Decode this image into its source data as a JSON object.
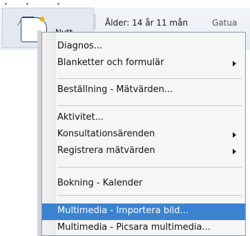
{
  "header": {
    "new_label": "Nytt",
    "age_info": "Ålder: 14 år 11 mån",
    "street_label": "Gatua"
  },
  "menu": {
    "items": [
      {
        "label": "Diagnos..."
      },
      {
        "label": "Blanketter och formulär"
      },
      {
        "label": "Beställning - Mätvärden..."
      },
      {
        "label": "Aktivitet..."
      },
      {
        "label": "Konsultationsärenden"
      },
      {
        "label": "Registrera mätvärden"
      },
      {
        "label": "Bokning - Kalender"
      },
      {
        "label": "Multimedia - Importera bild..."
      },
      {
        "label": "Multimedia - Picsara multimedia..."
      }
    ]
  },
  "colors": {
    "highlight": "#3a83d1",
    "menu_background": "#f6f6f6"
  }
}
